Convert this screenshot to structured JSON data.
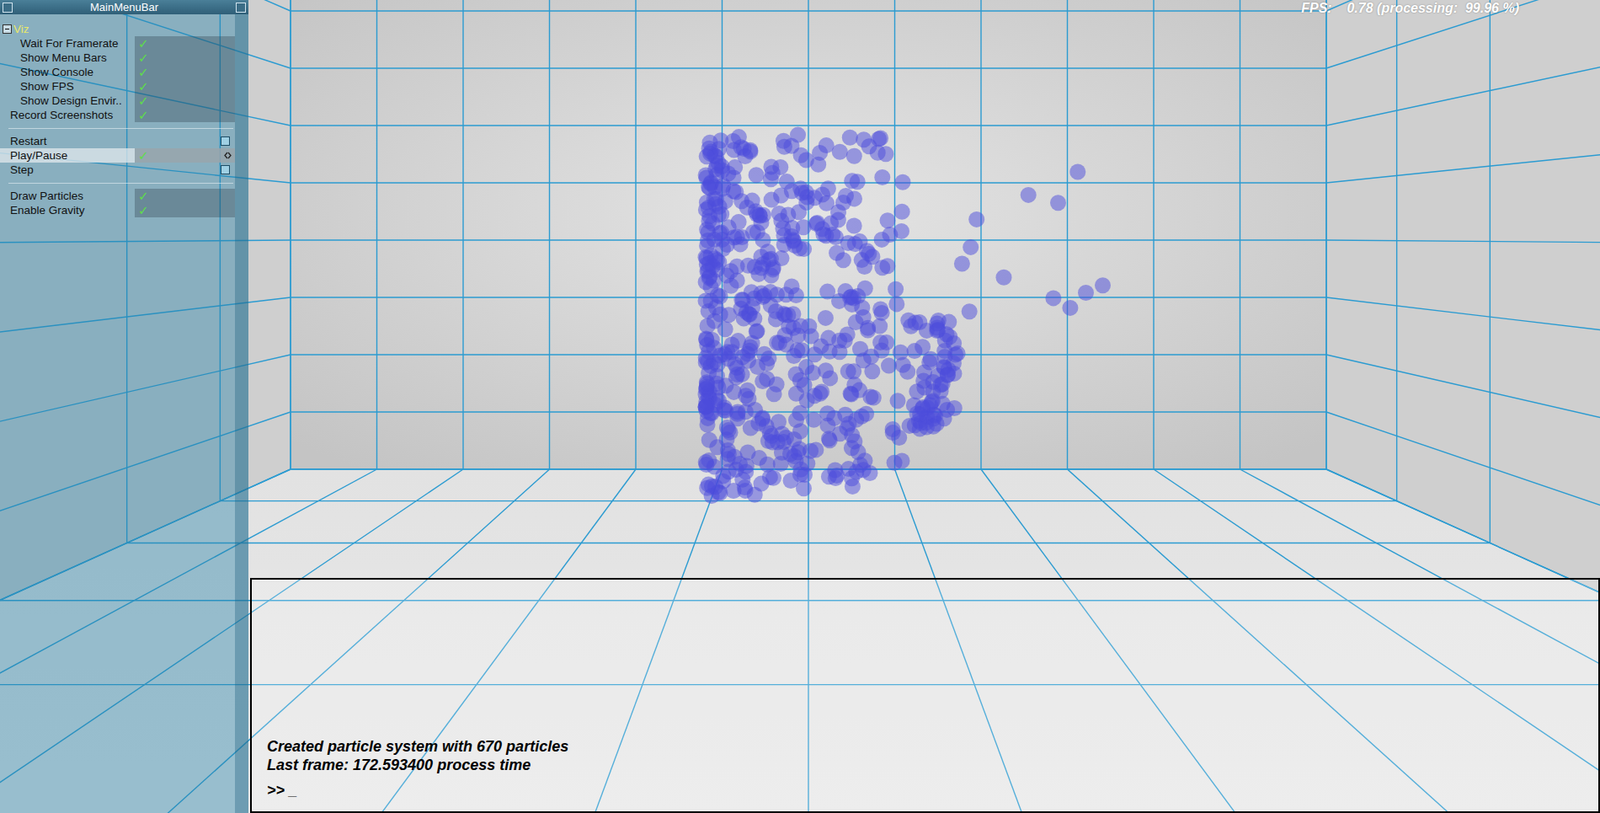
{
  "menu": {
    "title": "MainMenuBar",
    "check_glyph": "✓",
    "items": [
      {
        "kind": "group",
        "label": "Viz",
        "expanded": true,
        "in_group": false,
        "selected": false
      },
      {
        "kind": "toggle",
        "label": "Wait For Framerate",
        "checked": true,
        "in_group": true,
        "selected": false
      },
      {
        "kind": "toggle",
        "label": "Show Menu Bars",
        "checked": true,
        "in_group": true,
        "selected": false
      },
      {
        "kind": "toggle",
        "label": "Show Console",
        "checked": true,
        "in_group": true,
        "selected": false
      },
      {
        "kind": "toggle",
        "label": "Show FPS",
        "checked": true,
        "in_group": true,
        "selected": false
      },
      {
        "kind": "toggle",
        "label": "Show Design Envir..",
        "checked": true,
        "in_group": true,
        "selected": false
      },
      {
        "kind": "toggle",
        "label": "Record Screenshots",
        "checked": true,
        "in_group": false,
        "selected": false
      },
      {
        "kind": "separator"
      },
      {
        "kind": "button",
        "label": "Restart",
        "in_group": false,
        "selected": false
      },
      {
        "kind": "toggle",
        "label": "Play/Pause",
        "checked": true,
        "in_group": false,
        "selected": true
      },
      {
        "kind": "button",
        "label": "Step",
        "in_group": false,
        "selected": false
      },
      {
        "kind": "separator"
      },
      {
        "kind": "toggle",
        "label": "Draw Particles",
        "checked": true,
        "in_group": false,
        "selected": false
      },
      {
        "kind": "toggle",
        "label": "Enable Gravity",
        "checked": true,
        "in_group": false,
        "selected": false
      }
    ]
  },
  "hud": {
    "fps": "FPS:    0.78 (processing:  99.96 %)"
  },
  "console": {
    "lines": [
      "Created particle system with 670 particles",
      "Last frame: 172.593400 process time"
    ],
    "prompt": ">> _"
  }
}
